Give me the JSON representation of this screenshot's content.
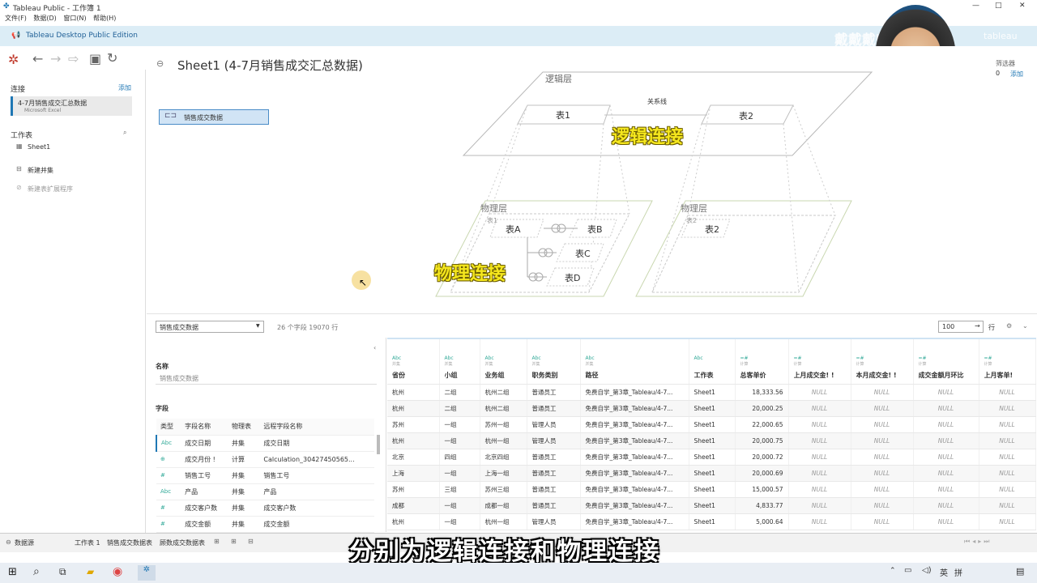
{
  "window": {
    "title": "Tableau Public - 工作簿 1",
    "controls": [
      "—",
      "□",
      "✕"
    ]
  },
  "menu": [
    "文件(F)",
    "数据(D)",
    "窗口(N)",
    "帮助(H)"
  ],
  "banner": {
    "text": "Tableau Desktop Public Edition",
    "watermark": "戴戴戴师兄",
    "watermark2": "tableau"
  },
  "left": {
    "connections_label": "连接",
    "add_label": "添加",
    "connection_name": "4-7月销售成交汇总数据",
    "connection_type": "Microsoft Excel",
    "sheets_label": "工作表",
    "sheet_item": "Sheet1",
    "new_union": "新建并集",
    "new_extension": "新建表扩展程序"
  },
  "canvas": {
    "title": "Sheet1 (4-7月销售成交汇总数据)",
    "table_pill": "销售成交数据",
    "filter_label": "筛选器",
    "filter_count": "0",
    "filter_add": "添加",
    "logic_layer": "逻辑层",
    "relation_line": "关系线",
    "table1": "表1",
    "table2": "表2",
    "logic_join": "逻辑连接",
    "physical_layer_left": "物理层",
    "physical_layer_right": "物理层",
    "small_table1": "表1",
    "small_table2": "表2",
    "tableA": "表A",
    "tableB": "表B",
    "tableC": "表C",
    "tableD": "表D",
    "right_table2": "表2",
    "physical_join": "物理连接"
  },
  "bottombar": {
    "dropdown_value": "销售成交数据",
    "summary": "26 个字段 19070 行",
    "rows_value": "100",
    "rows_label": "行"
  },
  "meta": {
    "name_label": "名称",
    "name_value": "销售成交数据",
    "fields_label": "字段",
    "headers": [
      "类型",
      "字段名称",
      "物理表",
      "远程字段名称"
    ],
    "rows": [
      {
        "type": "Abc",
        "name": "成交日期",
        "table": "并集",
        "remote": "成交日期"
      },
      {
        "type": "⊕",
        "name": "成交月份 !",
        "table": "计算",
        "remote": "Calculation_30427450565..."
      },
      {
        "type": "#",
        "name": "销售工号",
        "table": "并集",
        "remote": "销售工号"
      },
      {
        "type": "Abc",
        "name": "产品",
        "table": "并集",
        "remote": "产品"
      },
      {
        "type": "#",
        "name": "成交客户数",
        "table": "并集",
        "remote": "成交客户数"
      },
      {
        "type": "#",
        "name": "成交金额",
        "table": "并集",
        "remote": "成交金额"
      }
    ]
  },
  "grid": {
    "columns": [
      {
        "type": "Abc",
        "sub": "并集",
        "name": "省份"
      },
      {
        "type": "Abc",
        "sub": "并集",
        "name": "小组"
      },
      {
        "type": "Abc",
        "sub": "并集",
        "name": "业务组"
      },
      {
        "type": "Abc",
        "sub": "并集",
        "name": "职务类别"
      },
      {
        "type": "Abc",
        "sub": "并集",
        "name": "路径"
      },
      {
        "type": "Abc",
        "sub": "",
        "name": "工作表"
      },
      {
        "type": "=#",
        "sub": "计算",
        "name": "总客单价"
      },
      {
        "type": "=#",
        "sub": "计算",
        "name": "上月成交金! !"
      },
      {
        "type": "=#",
        "sub": "计算",
        "name": "本月成交金! !"
      },
      {
        "type": "=#",
        "sub": "计算",
        "name": "成交金额月环比"
      },
      {
        "type": "=#",
        "sub": "计算",
        "name": "上月客单!"
      }
    ],
    "rows": [
      [
        "杭州",
        "二组",
        "杭州二组",
        "普通员工",
        "免费自学_第3章_Tableau/4-7...",
        "Sheet1",
        "18,333.56",
        "NULL",
        "NULL",
        "NULL",
        "NULL"
      ],
      [
        "杭州",
        "二组",
        "杭州二组",
        "普通员工",
        "免费自学_第3章_Tableau/4-7...",
        "Sheet1",
        "20,000.25",
        "NULL",
        "NULL",
        "NULL",
        "NULL"
      ],
      [
        "苏州",
        "一组",
        "苏州一组",
        "管理人员",
        "免费自学_第3章_Tableau/4-7...",
        "Sheet1",
        "22,000.65",
        "NULL",
        "NULL",
        "NULL",
        "NULL"
      ],
      [
        "杭州",
        "一组",
        "杭州一组",
        "管理人员",
        "免费自学_第3章_Tableau/4-7...",
        "Sheet1",
        "20,000.75",
        "NULL",
        "NULL",
        "NULL",
        "NULL"
      ],
      [
        "北京",
        "四组",
        "北京四组",
        "普通员工",
        "免费自学_第3章_Tableau/4-7...",
        "Sheet1",
        "20,000.72",
        "NULL",
        "NULL",
        "NULL",
        "NULL"
      ],
      [
        "上海",
        "一组",
        "上海一组",
        "普通员工",
        "免费自学_第3章_Tableau/4-7...",
        "Sheet1",
        "20,000.69",
        "NULL",
        "NULL",
        "NULL",
        "NULL"
      ],
      [
        "苏州",
        "三组",
        "苏州三组",
        "普通员工",
        "免费自学_第3章_Tableau/4-7...",
        "Sheet1",
        "15,000.57",
        "NULL",
        "NULL",
        "NULL",
        "NULL"
      ],
      [
        "成都",
        "一组",
        "成都一组",
        "普通员工",
        "免费自学_第3章_Tableau/4-7...",
        "Sheet1",
        "4,833.77",
        "NULL",
        "NULL",
        "NULL",
        "NULL"
      ],
      [
        "杭州",
        "一组",
        "杭州一组",
        "管理人员",
        "免费自学_第3章_Tableau/4-7...",
        "Sheet1",
        "5,000.64",
        "NULL",
        "NULL",
        "NULL",
        "NULL"
      ]
    ]
  },
  "tabs": {
    "datasource": "数据源",
    "items": [
      "工作表 1",
      "销售成交数据表",
      "顾数成交数据表"
    ]
  },
  "subtitle": "分别为逻辑连接和物理连接",
  "taskbar": {
    "ime": "英",
    "ime2": "拼"
  },
  "colors": {
    "accent": "#1f77b4",
    "banner": "#dcedf6",
    "yellow": "#f5e71e"
  }
}
